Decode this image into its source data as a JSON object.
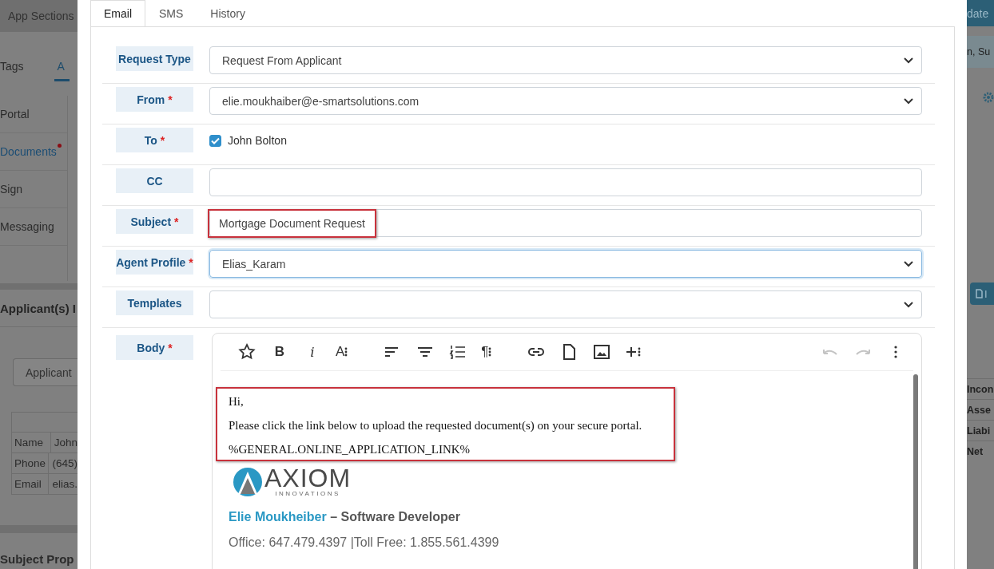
{
  "background_left": {
    "menu_button": "App Sections",
    "tabs": [
      {
        "label": "Tags",
        "selected": false
      },
      {
        "label": "A",
        "selected": true
      }
    ],
    "nav": [
      {
        "label": "Portal",
        "selected": false,
        "alert": false
      },
      {
        "label": "Documents",
        "selected": true,
        "alert": true
      },
      {
        "label": "Sign",
        "selected": false,
        "alert": false
      },
      {
        "label": "Messaging",
        "selected": false,
        "alert": false
      }
    ],
    "section_title": "Applicant(s) I",
    "applicant_button": "Applicant",
    "info_rows": [
      {
        "label": "Name",
        "value": "John"
      },
      {
        "label": "Phone",
        "value": "(645)"
      },
      {
        "label": "Email",
        "value": "elias."
      }
    ],
    "section_title_2": "Subject Prop"
  },
  "background_right": {
    "update_button": "date",
    "header": "n, Su",
    "import_button": "I",
    "rows": [
      "Incon",
      "Asse",
      "Liabi",
      "Net"
    ]
  },
  "modal": {
    "tabs": [
      {
        "label": "Email",
        "selected": true
      },
      {
        "label": "SMS",
        "selected": false
      },
      {
        "label": "History",
        "selected": false
      }
    ],
    "rows": [
      {
        "kind": "select",
        "label": "Request Type",
        "value": "Request From Applicant"
      },
      {
        "kind": "select",
        "label": "From",
        "marker": "*",
        "value": "elie.moukhaiber@e-smartsolutions.com"
      },
      {
        "kind": "checkbox",
        "label": "To",
        "marker": "*",
        "value": "John Bolton",
        "checked": true
      },
      {
        "kind": "input",
        "label": "CC"
      },
      {
        "kind": "input",
        "label": "Subject",
        "marker": "*",
        "value": "Mortgage Document Request",
        "highlighted": true
      },
      {
        "kind": "select",
        "label": "Agent Profile",
        "marker": "*",
        "value": "Elias_Karam",
        "focused": true
      },
      {
        "kind": "select",
        "label": "Templates"
      },
      {
        "kind": "body",
        "label": "Body",
        "marker": "*"
      }
    ],
    "toolbar": [
      [
        {
          "kind": "star"
        },
        {
          "kind": "bold",
          "glyph": "B"
        },
        {
          "kind": "italic",
          "glyph": "i"
        },
        {
          "kind": "text",
          "glyph": "A",
          "more": true
        }
      ],
      [
        {
          "kind": "align-left"
        },
        {
          "kind": "align-center"
        },
        {
          "kind": "list"
        },
        {
          "kind": "text",
          "glyph": "¶",
          "more": true
        }
      ],
      [
        {
          "kind": "link"
        },
        {
          "kind": "file"
        },
        {
          "kind": "image"
        },
        {
          "kind": "plus",
          "more": true
        }
      ],
      [
        {
          "kind": "undo",
          "disabled": true
        },
        {
          "kind": "redo",
          "disabled": true
        },
        {
          "kind": "more"
        }
      ]
    ],
    "message": {
      "highlighted": true,
      "lines": [
        "Hi,",
        "Please click the link below to upload the requested document(s) on your secure portal.",
        "%GENERAL.ONLINE_APPLICATION_LINK%"
      ]
    },
    "signature": {
      "logo_word": "AXIOM",
      "logo_sub": "INNOVATIONS",
      "name": "Elie Moukheiber",
      "title": "– Software Developer",
      "office": "Office: 647.479.4397 |Toll Free: 1.855.561.4399"
    }
  }
}
